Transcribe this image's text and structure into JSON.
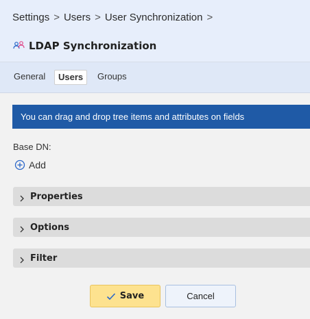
{
  "breadcrumb": {
    "items": [
      "Settings",
      "Users",
      "User Synchronization"
    ],
    "separator": ">"
  },
  "page": {
    "title": "LDAP Synchronization",
    "title_icon": "users-sync-icon"
  },
  "tabs": [
    {
      "label": "General",
      "selected": false
    },
    {
      "label": "Users",
      "selected": true
    },
    {
      "label": "Groups",
      "selected": false
    }
  ],
  "info_banner": {
    "text": "You can drag and drop tree items and attributes on fields"
  },
  "base_dn": {
    "label": "Base DN:",
    "add_label": "Add",
    "add_icon": "plus-circle-icon"
  },
  "sections": [
    {
      "label": "Properties",
      "expanded": false
    },
    {
      "label": "Options",
      "expanded": false
    },
    {
      "label": "Filter",
      "expanded": false
    }
  ],
  "actions": {
    "save_label": "Save",
    "cancel_label": "Cancel"
  },
  "colors": {
    "header_bg": "#e7eefb",
    "banner_bg": "#1f5aa6",
    "save_bg": "#fde28f",
    "accent": "#1f5aa6"
  }
}
